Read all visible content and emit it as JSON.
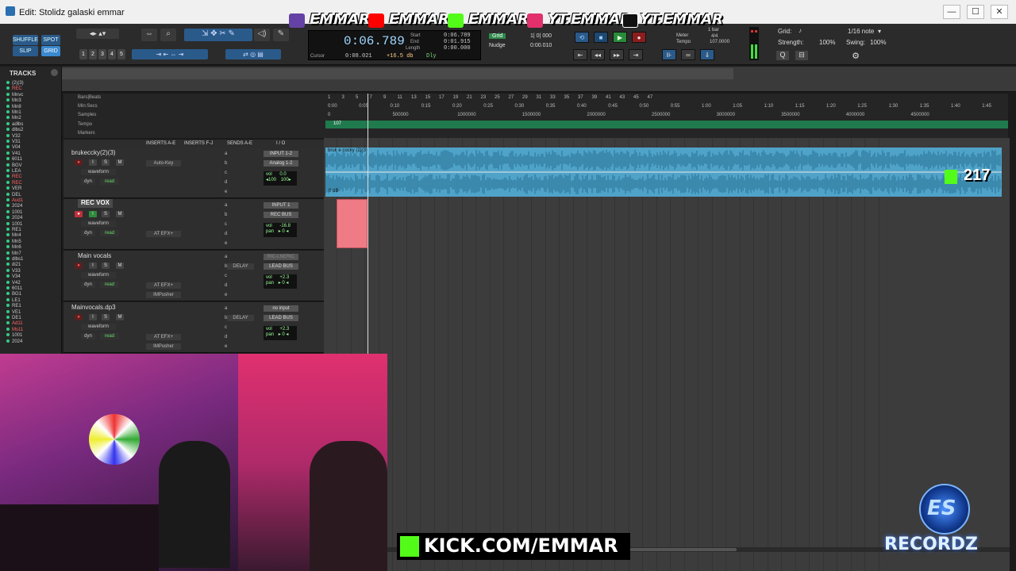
{
  "window": {
    "title": "Edit: Stolidz galaski emmar",
    "minimize_label": "—",
    "maximize_label": "☐",
    "close_label": "✕"
  },
  "toolbar": {
    "mode_shuffle": "SHUFFLE",
    "mode_spot": "SPOT",
    "mode_slip": "SLIP",
    "mode_grid": "GRID",
    "zoom_presets": [
      "1",
      "2",
      "3",
      "4",
      "5"
    ],
    "counter_main": "0:06.789",
    "counter_labels": [
      "Start",
      "End",
      "Length"
    ],
    "counter_values": [
      "0:06.789",
      "0:01.915",
      "0:00.000"
    ],
    "cursor_label": "Cursor",
    "cursor_value": "0:08.021",
    "cursor_db": "+16.5 db",
    "dly_label": "Dly",
    "grid_mode": "Grid",
    "grid_value": "1| 0| 000",
    "nudge_label": "Nudge",
    "nudge_value": "0:00.010",
    "meter_label": "Meter",
    "meter_value": "4/4",
    "tempo_label": "Tempo",
    "tempo_value": "107.0000",
    "bar_label": "1 bar",
    "grid_panel_label": "Grid:",
    "grid_note": "1/16 note",
    "strength_label": "Strength:",
    "strength_value": "100%",
    "swing_label": "Swing:",
    "swing_value": "100%"
  },
  "social": {
    "handles": [
      "EMMAR",
      "EMMAR",
      "EMMAR",
      "YT.EMMAR",
      "YT.EMMAR"
    ],
    "colors": [
      "#6441a5",
      "#ff0000",
      "#53fc18",
      "#e1306c",
      "#111111"
    ]
  },
  "tracks_panel": {
    "header": "TRACKS",
    "items": [
      "(2)(3)",
      "REC",
      "Mnvc",
      "Mn3",
      "Mn8",
      "Mn1",
      "Mn2",
      "adlbs",
      "dlbs2",
      "V32",
      "V31",
      "V04",
      "V41",
      "6011",
      "BGV",
      "LEA",
      "REC",
      "REC",
      "VER",
      "DEL",
      "Aud1",
      "2024",
      "1001",
      "2024",
      "1001",
      "RE1",
      "Mn4",
      "Mn5",
      "Mn6",
      "Mn7",
      "dlbs1",
      "di21",
      "V33",
      "V34",
      "V42",
      "6011",
      "BG1",
      "LE1",
      "RE1",
      "VE1",
      "DE1",
      "Ad11",
      "Ms11",
      "1001",
      "2024"
    ]
  },
  "rulers": {
    "labels": [
      "Bars|Beats",
      "Min:Secs",
      "Samples",
      "Tempo",
      "Markers"
    ],
    "bars": [
      "1",
      "3",
      "5",
      "7",
      "9",
      "11",
      "13",
      "15",
      "17",
      "19",
      "21",
      "23",
      "25",
      "27",
      "29",
      "31",
      "33",
      "35",
      "37",
      "39",
      "41",
      "43",
      "45",
      "47"
    ],
    "secs": [
      "0:00",
      "0:05",
      "0:10",
      "0:15",
      "0:20",
      "0:25",
      "0:30",
      "0:35",
      "0:40",
      "0:45",
      "0:50",
      "0:55",
      "1:00",
      "1:05",
      "1:10",
      "1:15",
      "1:20",
      "1:25",
      "1:30",
      "1:35",
      "1:40",
      "1:45"
    ],
    "samples": [
      "0",
      "500000",
      "1000000",
      "1500000",
      "2000000",
      "2500000",
      "3000000",
      "3500000",
      "4000000",
      "4500000"
    ],
    "tempo_marker": "107"
  },
  "column_headers": {
    "inserts_ae": "INSERTS A-E",
    "inserts_fj": "INSERTS F-J",
    "sends_ae": "SENDS A-E",
    "io": "I / O"
  },
  "tracks": [
    {
      "name": "brukeccky(2)(3)",
      "view": "waveform",
      "mode": "dyn",
      "mode2": "read",
      "insert": "Auto-Key",
      "input": "INPUT 1-2",
      "output": "Analog 1-2",
      "vol": "0.0",
      "pan_l": "◂100",
      "pan_r": "100▸",
      "clip_label": "bruk e cocky (2)(3)"
    },
    {
      "name": "REC VOX",
      "view": "waveform",
      "mode": "dyn",
      "mode2": "read",
      "insert": "AT EFX+",
      "input": "INPUT 1",
      "output": "REC BUS",
      "vol": "-16.8",
      "pan": "▸ 0 ◂"
    },
    {
      "name": "Main vocals",
      "view": "waveform",
      "mode": "dyn",
      "mode2": "read",
      "insert": "AT EFX+",
      "insert2": "IMPusher",
      "send": "DELAY",
      "input": "RIC-LNERIC",
      "output": "LEAD BUS",
      "vol": "+2.3",
      "pan": "▸ 0 ◂"
    },
    {
      "name": "Mainvocals.dp3",
      "view": "waveform",
      "mode": "dyn",
      "mode2": "read",
      "insert": "AT EFX+",
      "insert2": "IMPusher",
      "send": "DELAY",
      "input": "no input",
      "output": "LEAD BUS",
      "vol": "+2.3",
      "pan": "▸ 0 ◂"
    }
  ],
  "track_letters": [
    "a",
    "b",
    "c",
    "d",
    "e"
  ],
  "track_buttons": [
    "I",
    "S",
    "M"
  ],
  "labels": {
    "vol": "vol",
    "pan": "pan",
    "clip_db": "0 dB"
  },
  "overlay": {
    "kick_count": "217",
    "kick_url": "KICK.COM/EMMAR",
    "logo_text": "RECORDZ",
    "logo_mono": "ES"
  }
}
